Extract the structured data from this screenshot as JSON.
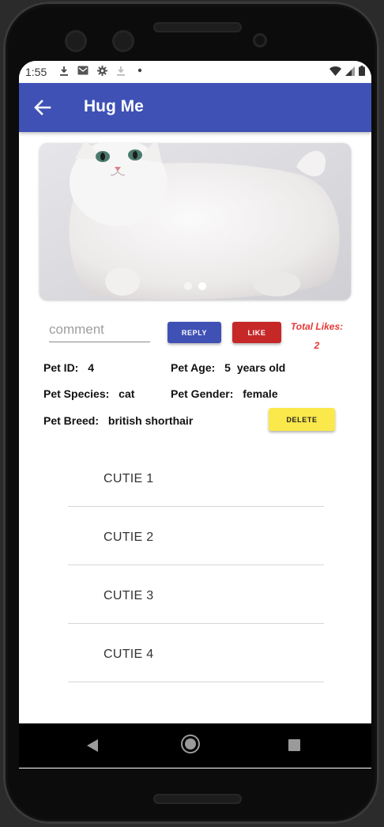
{
  "status_bar": {
    "time": "1:55",
    "icons_left": [
      "download-icon",
      "gmail-icon",
      "settings-icon",
      "download-faded-icon",
      "dot-icon"
    ],
    "icons_right": [
      "wifi-icon",
      "signal-icon",
      "battery-icon"
    ]
  },
  "app_bar": {
    "title": "Hug Me",
    "color": "#3f51b5"
  },
  "carousel": {
    "image": "white british shorthair cat photo",
    "slide_count": 2,
    "active_index": 1
  },
  "comment": {
    "placeholder": "comment",
    "value": ""
  },
  "buttons": {
    "reply": "REPLY",
    "like": "LIKE",
    "delete": "DELETE"
  },
  "likes": {
    "label": "Total Likes:",
    "count": "2"
  },
  "pet": {
    "id_label": "Pet ID:",
    "id": "4",
    "age_label": "Pet Age:",
    "age": "5",
    "age_unit": "years old",
    "species_label": "Pet Species:",
    "species": "cat",
    "gender_label": "Pet Gender:",
    "gender": "female",
    "breed_label": "Pet Breed:",
    "breed": "british shorthair"
  },
  "list": [
    {
      "label": "CUTIE 1"
    },
    {
      "label": "CUTIE 2"
    },
    {
      "label": "CUTIE 3"
    },
    {
      "label": "CUTIE 4"
    }
  ],
  "colors": {
    "primary": "#3f51b5",
    "like": "#c62828",
    "delete": "#fbe84a",
    "likes_text": "#e53935"
  }
}
